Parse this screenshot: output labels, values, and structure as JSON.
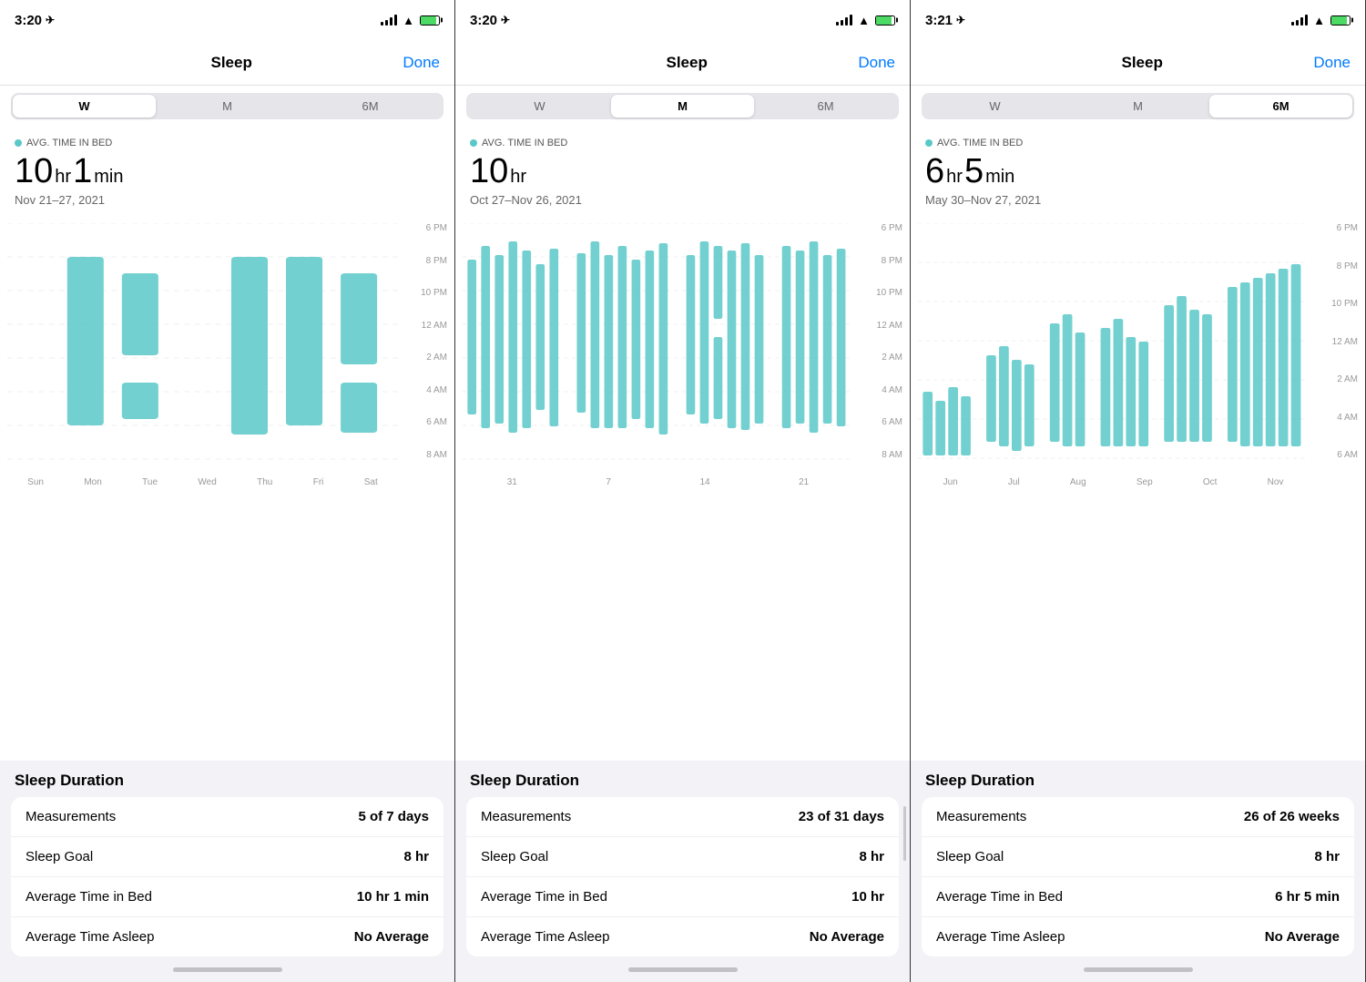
{
  "panels": [
    {
      "id": "panel-week",
      "status": {
        "time": "3:20",
        "location": true,
        "signal": [
          2,
          3,
          4,
          5
        ],
        "wifi": true,
        "battery": 90
      },
      "nav": {
        "title": "Sleep",
        "done_label": "Done"
      },
      "segments": {
        "options": [
          "W",
          "M",
          "6M"
        ],
        "active": "W"
      },
      "metric": {
        "avg_label": "AVG. TIME IN BED",
        "value_hr": "10",
        "value_min": "1",
        "has_min": true,
        "date_range": "Nov 21–27, 2021"
      },
      "chart": {
        "y_labels": [
          "6 PM",
          "8 PM",
          "10 PM",
          "12 AM",
          "2 AM",
          "4 AM",
          "6 AM",
          "8 AM"
        ],
        "x_labels": [
          "Sun",
          "Mon",
          "Tue",
          "Wed",
          "Thu",
          "Fri",
          "Sat"
        ]
      },
      "stats": {
        "title": "Sleep Duration",
        "rows": [
          {
            "label": "Measurements",
            "value": "5 of 7 days"
          },
          {
            "label": "Sleep Goal",
            "value": "8 hr"
          },
          {
            "label": "Average Time in Bed",
            "value": "10 hr 1 min"
          },
          {
            "label": "Average Time Asleep",
            "value": "No Average"
          }
        ]
      }
    },
    {
      "id": "panel-month",
      "status": {
        "time": "3:20",
        "location": true,
        "signal": [
          2,
          3,
          4,
          5
        ],
        "wifi": true,
        "battery": 90
      },
      "nav": {
        "title": "Sleep",
        "done_label": "Done"
      },
      "segments": {
        "options": [
          "W",
          "M",
          "6M"
        ],
        "active": "M"
      },
      "metric": {
        "avg_label": "AVG. TIME IN BED",
        "value_hr": "10",
        "value_min": "",
        "has_min": false,
        "date_range": "Oct 27–Nov 26, 2021"
      },
      "chart": {
        "y_labels": [
          "6 PM",
          "8 PM",
          "10 PM",
          "12 AM",
          "2 AM",
          "4 AM",
          "6 AM",
          "8 AM"
        ],
        "x_labels": [
          "31",
          "7",
          "14",
          "21"
        ]
      },
      "stats": {
        "title": "Sleep Duration",
        "rows": [
          {
            "label": "Measurements",
            "value": "23 of 31 days"
          },
          {
            "label": "Sleep Goal",
            "value": "8 hr"
          },
          {
            "label": "Average Time in Bed",
            "value": "10 hr"
          },
          {
            "label": "Average Time Asleep",
            "value": "No Average"
          }
        ]
      }
    },
    {
      "id": "panel-6month",
      "status": {
        "time": "3:21",
        "location": true,
        "signal": [
          2,
          3,
          4,
          5
        ],
        "wifi": true,
        "battery": 90
      },
      "nav": {
        "title": "Sleep",
        "done_label": "Done"
      },
      "segments": {
        "options": [
          "W",
          "M",
          "6M"
        ],
        "active": "6M"
      },
      "metric": {
        "avg_label": "AVG. TIME IN BED",
        "value_hr": "6",
        "value_min": "5",
        "has_min": true,
        "date_range": "May 30–Nov 27, 2021"
      },
      "chart": {
        "y_labels": [
          "6 PM",
          "8 PM",
          "10 PM",
          "12 AM",
          "2 AM",
          "4 AM",
          "6 AM"
        ],
        "x_labels": [
          "Jun",
          "Jul",
          "Aug",
          "Sep",
          "Oct",
          "Nov"
        ]
      },
      "stats": {
        "title": "Sleep Duration",
        "rows": [
          {
            "label": "Measurements",
            "value": "26 of 26 weeks"
          },
          {
            "label": "Sleep Goal",
            "value": "8 hr"
          },
          {
            "label": "Average Time in Bed",
            "value": "6 hr 5 min"
          },
          {
            "label": "Average Time Asleep",
            "value": "No Average"
          }
        ]
      }
    }
  ]
}
